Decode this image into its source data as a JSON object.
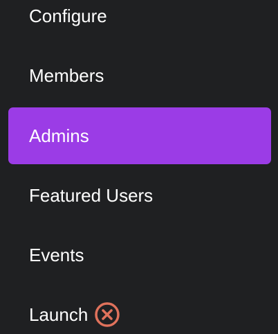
{
  "sidebar": {
    "items": [
      {
        "label": "Configure",
        "active": false
      },
      {
        "label": "Members",
        "active": false
      },
      {
        "label": "Admins",
        "active": true
      },
      {
        "label": "Featured Users",
        "active": false
      },
      {
        "label": "Events",
        "active": false
      },
      {
        "label": "Launch",
        "active": false,
        "status_icon": "close-circle-icon"
      }
    ]
  },
  "colors": {
    "background": "#1f2022",
    "active_item": "#9b3ce6",
    "text": "#ffffff",
    "launch_status_icon": "#e0725c"
  }
}
